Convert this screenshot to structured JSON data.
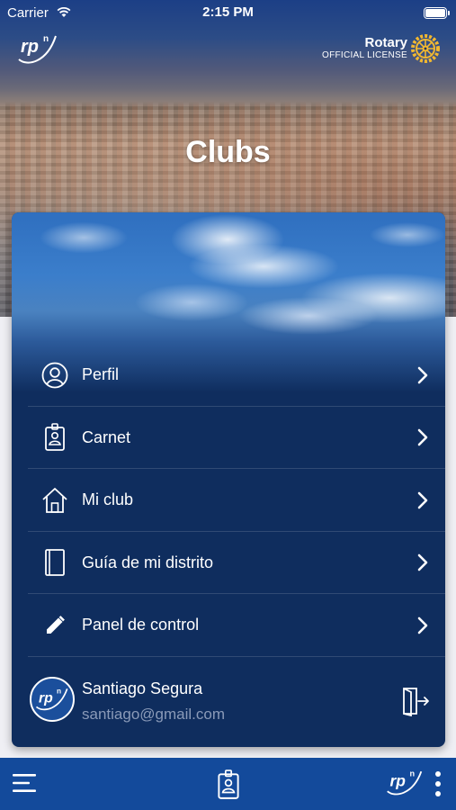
{
  "status_bar": {
    "carrier": "Carrier",
    "time": "2:15 PM"
  },
  "header": {
    "rotary_name": "Rotary",
    "rotary_license": "OFFICIAL LICENSE",
    "title": "Clubs"
  },
  "menu": {
    "items": [
      {
        "label": "Perfil",
        "icon": "user-circle-icon"
      },
      {
        "label": "Carnet",
        "icon": "id-badge-icon"
      },
      {
        "label": "Mi club",
        "icon": "home-icon"
      },
      {
        "label": "Guía de mi distrito",
        "icon": "book-icon"
      },
      {
        "label": "Panel de control",
        "icon": "pencil-icon"
      }
    ]
  },
  "profile": {
    "name": "Santiago Segura",
    "email": "santiago@gmail.com"
  },
  "colors": {
    "card": "#0f2d5e",
    "tabbar": "#134a9b",
    "email": "#8a9ab8"
  }
}
